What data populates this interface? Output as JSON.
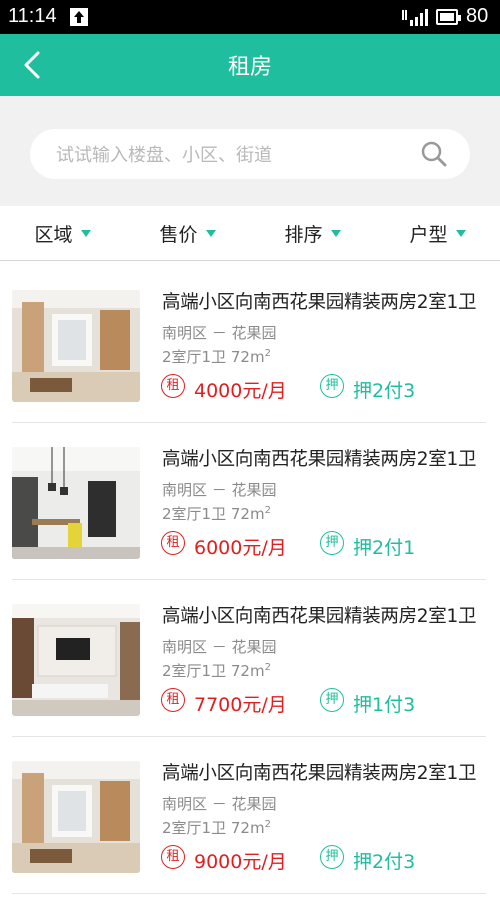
{
  "status_bar": {
    "time": "11:14",
    "battery": "80"
  },
  "header": {
    "title": "租房"
  },
  "search": {
    "placeholder": "试试输入楼盘、小区、街道"
  },
  "filters": [
    {
      "label": "区域"
    },
    {
      "label": "售价"
    },
    {
      "label": "排序"
    },
    {
      "label": "户型"
    }
  ],
  "listings": [
    {
      "title": "高端小区向南西花果园精装两房2室1卫",
      "area": "南明区 － 花果园",
      "layout": "2室厅1卫   72m",
      "sup": "2",
      "price_badge": "租",
      "price": "4000元/月",
      "deposit_badge": "押",
      "deposit": "押2付3"
    },
    {
      "title": "高端小区向南西花果园精装两房2室1卫",
      "area": "南明区 － 花果园",
      "layout": "2室厅1卫   72m",
      "sup": "2",
      "price_badge": "租",
      "price": "6000元/月",
      "deposit_badge": "押",
      "deposit": "押2付1"
    },
    {
      "title": "高端小区向南西花果园精装两房2室1卫",
      "area": "南明区 － 花果园",
      "layout": "2室厅1卫   72m",
      "sup": "2",
      "price_badge": "租",
      "price": "7700元/月",
      "deposit_badge": "押",
      "deposit": "押1付3"
    },
    {
      "title": "高端小区向南西花果园精装两房2室1卫",
      "area": "南明区 － 花果园",
      "layout": "2室厅1卫   72m",
      "sup": "2",
      "price_badge": "租",
      "price": "9000元/月",
      "deposit_badge": "押",
      "deposit": "押2付3"
    }
  ],
  "colors": {
    "accent": "#1fbe9e",
    "price": "#e02020"
  }
}
